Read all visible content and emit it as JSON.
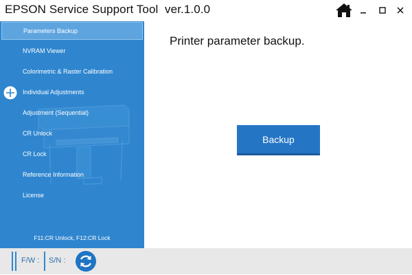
{
  "app": {
    "title": "EPSON Service Support Tool  ver.1.0.0"
  },
  "window_controls": [
    "home-icon",
    "minimize-icon",
    "maximize-icon",
    "close-icon"
  ],
  "sidebar": {
    "items": [
      {
        "label": "Parameters Backup",
        "selected": true
      },
      {
        "label": "NVRAM Viewer"
      },
      {
        "label": "Colorimetric & Raster Calibration"
      },
      {
        "label": "Individual Adjustments",
        "expandable": true
      },
      {
        "label": "Adjustment (Sequential)"
      },
      {
        "label": "CR Unlock"
      },
      {
        "label": "CR Lock"
      },
      {
        "label": "Reference Information"
      },
      {
        "label": "License"
      }
    ],
    "shortcut_hint": "F11:CR Unlock, F12:CR Lock"
  },
  "main": {
    "heading": "Printer parameter backup.",
    "backup_label": "Backup"
  },
  "status_bar": {
    "fw_label": "F/W :",
    "sn_label": "S/N :"
  },
  "colors": {
    "sidebar": "#2f86cf",
    "sidebar_selected": "#5ea5e0",
    "button": "#2475c4",
    "status_bar": "#e8e8e8"
  }
}
